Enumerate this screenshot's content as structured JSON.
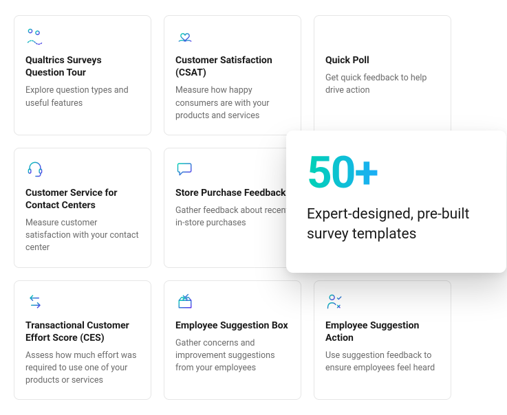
{
  "cards": [
    {
      "title": "Qualtrics Surveys Question Tour",
      "desc": "Explore question types and useful features"
    },
    {
      "title": "Customer Satisfaction (CSAT)",
      "desc": "Measure how happy consumers are with your products and services"
    },
    {
      "title": "Quick Poll",
      "desc": "Get quick feedback to help drive action"
    },
    {
      "title": "Customer Service for Contact Centers",
      "desc": "Measure customer satisfaction with your contact center"
    },
    {
      "title": "Store Purchase Feedback",
      "desc": "Gather feedback about recent in-store purchases"
    },
    {
      "title": "",
      "desc": ""
    },
    {
      "title": "Transactional Customer Effort Score (CES)",
      "desc": "Assess how much effort was required to use one of your products or services"
    },
    {
      "title": "Employee Suggestion Box",
      "desc": "Gather concerns and improvement suggestions from your employees"
    },
    {
      "title": "Employee Suggestion Action",
      "desc": "Use suggestion feedback to ensure employees feel heard"
    }
  ],
  "overlay": {
    "number": "50+",
    "text": "Expert-designed, pre-built survey templates"
  }
}
